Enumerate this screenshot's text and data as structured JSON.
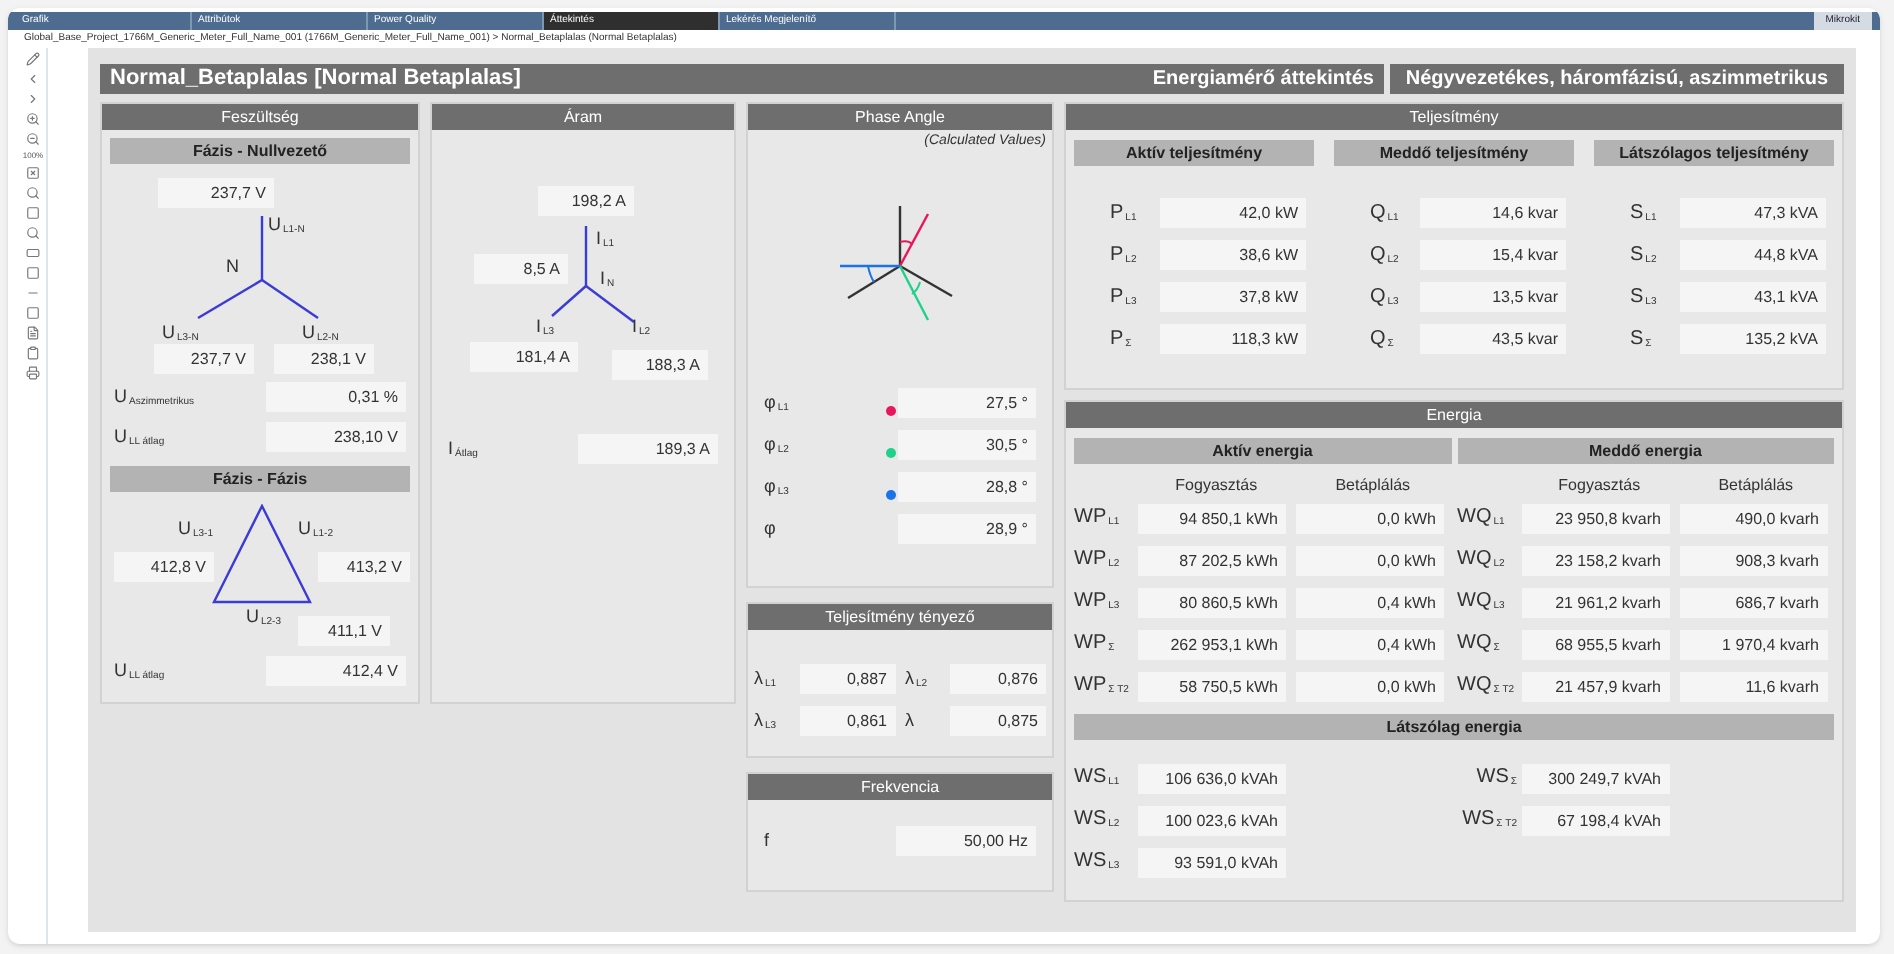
{
  "top_tabs": [
    {
      "label": "Grafik",
      "selected": false
    },
    {
      "label": "Attribútok",
      "selected": false
    },
    {
      "label": "Power Quality",
      "selected": false
    },
    {
      "label": "Áttekintés",
      "selected": true
    },
    {
      "label": "Lekérés Megjelenítő",
      "selected": false
    }
  ],
  "user": "Mikrokit",
  "breadcrumb": "Global_Base_Project_1766M_Generic_Meter_Full_Name_001 (1766M_Generic_Meter_Full_Name_001)  >  Normal_Betaplalas (Normal Betaplalas)",
  "toolbar": {
    "zoom": "100%"
  },
  "header": {
    "title": "Normal_Betaplalas [Normal Betaplalas]",
    "view": "Energiamérő áttekintés",
    "system": "Négyvezetékes, háromfázisú, aszimmetrikus"
  },
  "voltage": {
    "title": "Feszültség",
    "phase_neutral": {
      "title": "Fázis - Nullvezető",
      "center": "N",
      "phases": [
        {
          "symbol": "U",
          "sub": "L1-N",
          "value": "237,7 V"
        },
        {
          "symbol": "U",
          "sub": "L3-N",
          "value": "237,7 V"
        },
        {
          "symbol": "U",
          "sub": "L2-N",
          "value": "238,1 V"
        }
      ],
      "rows": [
        {
          "symbol": "U",
          "sub": "Aszimmetrikus",
          "value": "0,31 %"
        },
        {
          "symbol": "U",
          "sub": "LL átlag",
          "value": "238,10 V"
        }
      ]
    },
    "phase_phase": {
      "title": "Fázis - Fázis",
      "phases": [
        {
          "symbol": "U",
          "sub": "L3-1",
          "value": "412,8 V"
        },
        {
          "symbol": "U",
          "sub": "L1-2",
          "value": "413,2 V"
        },
        {
          "symbol": "U",
          "sub": "L2-3",
          "value": "411,1 V"
        }
      ],
      "average": {
        "symbol": "U",
        "sub": "LL átlag",
        "value": "412,4 V"
      }
    }
  },
  "current": {
    "title": "Áram",
    "phases": [
      {
        "symbol": "I",
        "sub": "L1",
        "value": "198,2 A"
      },
      {
        "symbol": "I",
        "sub": "N",
        "value": "8,5 A"
      },
      {
        "symbol": "I",
        "sub": "L3",
        "value": "181,4 A"
      },
      {
        "symbol": "I",
        "sub": "L2",
        "value": "188,3 A"
      }
    ],
    "average": {
      "symbol": "I",
      "sub": "Átlag",
      "value": "189,3 A"
    }
  },
  "phase_angle": {
    "title": "Phase Angle",
    "note": "(Calculated Values)",
    "rows": [
      {
        "symbol": "φ",
        "sub": "L1",
        "value": "27,5 °",
        "color": "#e8175d"
      },
      {
        "symbol": "φ",
        "sub": "L2",
        "value": "30,5 °",
        "color": "#1fd18a"
      },
      {
        "symbol": "φ",
        "sub": "L3",
        "value": "28,8 °",
        "color": "#1a73e8"
      },
      {
        "symbol": "φ",
        "value": "28,9 °"
      }
    ]
  },
  "power_factor": {
    "title": "Teljesítmény tényező",
    "items": [
      {
        "symbol": "λ",
        "sub": "L1",
        "value": "0,887"
      },
      {
        "symbol": "λ",
        "sub": "L2",
        "value": "0,876"
      },
      {
        "symbol": "λ",
        "sub": "L3",
        "value": "0,861"
      },
      {
        "symbol": "λ",
        "value": "0,875"
      }
    ]
  },
  "frequency": {
    "title": "Frekvencia",
    "symbol": "f",
    "value": "50,00 Hz"
  },
  "power": {
    "title": "Teljesítmény",
    "groups": [
      {
        "title": "Aktív teljesítmény",
        "rows": [
          {
            "symbol": "P",
            "sub": "L1",
            "value": "42,0 kW"
          },
          {
            "symbol": "P",
            "sub": "L2",
            "value": "38,6 kW"
          },
          {
            "symbol": "P",
            "sub": "L3",
            "value": "37,8 kW"
          },
          {
            "symbol": "P",
            "sub": "Σ",
            "value": "118,3 kW"
          }
        ]
      },
      {
        "title": "Meddő teljesítmény",
        "rows": [
          {
            "symbol": "Q",
            "sub": "L1",
            "value": "14,6 kvar"
          },
          {
            "symbol": "Q",
            "sub": "L2",
            "value": "15,4 kvar"
          },
          {
            "symbol": "Q",
            "sub": "L3",
            "value": "13,5 kvar"
          },
          {
            "symbol": "Q",
            "sub": "Σ",
            "value": "43,5 kvar"
          }
        ]
      },
      {
        "title": "Látszólagos teljesítmény",
        "rows": [
          {
            "symbol": "S",
            "sub": "L1",
            "value": "47,3 kVA"
          },
          {
            "symbol": "S",
            "sub": "L2",
            "value": "44,8 kVA"
          },
          {
            "symbol": "S",
            "sub": "L3",
            "value": "43,1 kVA"
          },
          {
            "symbol": "S",
            "sub": "Σ",
            "value": "135,2 kVA"
          }
        ]
      }
    ]
  },
  "energy": {
    "title": "Energia",
    "groups": [
      {
        "title": "Aktív energia",
        "columns": [
          "Fogyasztás",
          "Betáplálás"
        ],
        "rows": [
          {
            "symbol": "WP",
            "sub": "L1",
            "values": [
              "94 850,1 kWh",
              "0,0 kWh"
            ]
          },
          {
            "symbol": "WP",
            "sub": "L2",
            "values": [
              "87 202,5 kWh",
              "0,0 kWh"
            ]
          },
          {
            "symbol": "WP",
            "sub": "L3",
            "values": [
              "80 860,5 kWh",
              "0,4 kWh"
            ]
          },
          {
            "symbol": "WP",
            "sub": "Σ",
            "values": [
              "262 953,1 kWh",
              "0,4 kWh"
            ]
          },
          {
            "symbol": "WP",
            "sub": "Σ T2",
            "values": [
              "58 750,5 kWh",
              "0,0 kWh"
            ]
          }
        ]
      },
      {
        "title": "Meddő energia",
        "columns": [
          "Fogyasztás",
          "Betáplálás"
        ],
        "rows": [
          {
            "symbol": "WQ",
            "sub": "L1",
            "values": [
              "23 950,8 kvarh",
              "490,0 kvarh"
            ]
          },
          {
            "symbol": "WQ",
            "sub": "L2",
            "values": [
              "23 158,2 kvarh",
              "908,3 kvarh"
            ]
          },
          {
            "symbol": "WQ",
            "sub": "L3",
            "values": [
              "21 961,2 kvarh",
              "686,7 kvarh"
            ]
          },
          {
            "symbol": "WQ",
            "sub": "Σ",
            "values": [
              "68 955,5 kvarh",
              "1 970,4 kvarh"
            ]
          },
          {
            "symbol": "WQ",
            "sub": "Σ T2",
            "values": [
              "21 457,9 kvarh",
              "11,6 kvarh"
            ]
          }
        ]
      }
    ],
    "apparent": {
      "title": "Látszólag energia",
      "left": [
        {
          "symbol": "WS",
          "sub": "L1",
          "value": "106 636,0 kVAh"
        },
        {
          "symbol": "WS",
          "sub": "L2",
          "value": "100 023,6 kVAh"
        },
        {
          "symbol": "WS",
          "sub": "L3",
          "value": "93 591,0 kVAh"
        }
      ],
      "right": [
        {
          "symbol": "WS",
          "sub": "Σ",
          "value": "300 249,7 kVAh"
        },
        {
          "symbol": "WS",
          "sub": "Σ T2",
          "value": "67 198,4 kVAh"
        }
      ]
    }
  }
}
